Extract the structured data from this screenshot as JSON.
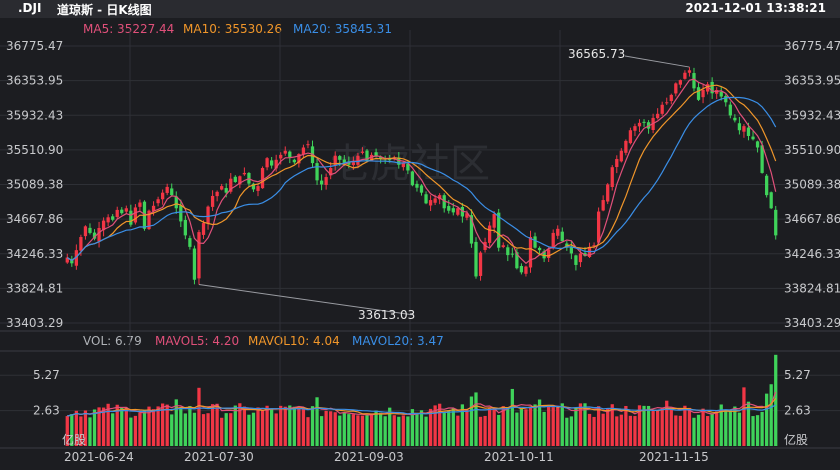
{
  "header": {
    "symbol": ".DJI",
    "title": "道琼斯 - 日K线图",
    "datetime": "2021-12-01 13:38:21"
  },
  "ma_legend": [
    {
      "label": "MA5: 35227.44",
      "color": "#e0507a"
    },
    {
      "label": "MA10: 35530.26",
      "color": "#f0962a"
    },
    {
      "label": "MA20: 35845.31",
      "color": "#3a8ee6"
    }
  ],
  "vol_legend": [
    {
      "label": "VOL: 6.79",
      "color": "#b0b3b8"
    },
    {
      "label": "MAVOL5: 4.20",
      "color": "#e0507a"
    },
    {
      "label": "MAVOL10: 4.04",
      "color": "#f0962a"
    },
    {
      "label": "MAVOL20: 3.47",
      "color": "#3a8ee6"
    }
  ],
  "price_axis_ticks": [
    "36775.47",
    "36353.95",
    "35932.43",
    "35510.90",
    "35089.38",
    "34667.86",
    "34246.33",
    "33824.81",
    "33403.29"
  ],
  "volume_axis_ticks": [
    "5.27",
    "2.63"
  ],
  "volume_unit": "亿股",
  "date_ticks": [
    "2021-06-24",
    "2021-07-30",
    "2021-09-03",
    "2021-10-11",
    "2021-11-15"
  ],
  "annotations": {
    "high": "36565.73",
    "low": "33613.03"
  },
  "watermark": "老虎社区",
  "colors": {
    "up": "#f23645",
    "down": "#3fd35a",
    "bg": "#1c1d21",
    "grid": "#2e3036",
    "axis_text": "#c8c9cc"
  },
  "chart_data": {
    "type": "candlestick",
    "title": "道琼斯 - 日K线图",
    "ylim": [
      33403.29,
      36775.47
    ],
    "volume_ylim": [
      0,
      7.0
    ],
    "closes": [
      34200,
      34130,
      34290,
      34450,
      34580,
      34500,
      34430,
      34560,
      34650,
      34690,
      34660,
      34780,
      34740,
      34800,
      34600,
      34810,
      34870,
      34550,
      34770,
      34830,
      34910,
      34990,
      35060,
      34960,
      34800,
      34640,
      34470,
      34330,
      33930,
      34510,
      34620,
      34820,
      34950,
      35000,
      35070,
      34990,
      35160,
      35120,
      35190,
      35230,
      35100,
      35030,
      35070,
      35290,
      35410,
      35320,
      35390,
      35450,
      35500,
      35420,
      35360,
      35460,
      35540,
      35580,
      35350,
      35140,
      35090,
      35180,
      35290,
      35440,
      35390,
      35350,
      35330,
      35360,
      35440,
      35490,
      35380,
      35450,
      35430,
      35400,
      35370,
      35390,
      35420,
      35330,
      35360,
      35260,
      35080,
      35050,
      34990,
      34860,
      34900,
      34920,
      34960,
      34800,
      34770,
      34750,
      34800,
      34700,
      34740,
      34370,
      33970,
      34260,
      34390,
      34590,
      34730,
      34320,
      34350,
      34230,
      34240,
      34070,
      34020,
      34090,
      34450,
      34320,
      34290,
      34190,
      34300,
      34500,
      34550,
      34400,
      34320,
      34250,
      34110,
      34250,
      34220,
      34330,
      34350,
      34760,
      34900,
      35090,
      35300,
      35400,
      35500,
      35620,
      35750,
      35800,
      35840,
      35850,
      35770,
      35900,
      35950,
      36060,
      36090,
      36180,
      36320,
      36360,
      36450,
      36480,
      36260,
      36120,
      36240,
      36310,
      36200,
      36240,
      36160,
      36090,
      35930,
      35870,
      35750,
      35800,
      35680,
      35640,
      35540,
      35230,
      34960,
      34800,
      34470
    ]
  }
}
